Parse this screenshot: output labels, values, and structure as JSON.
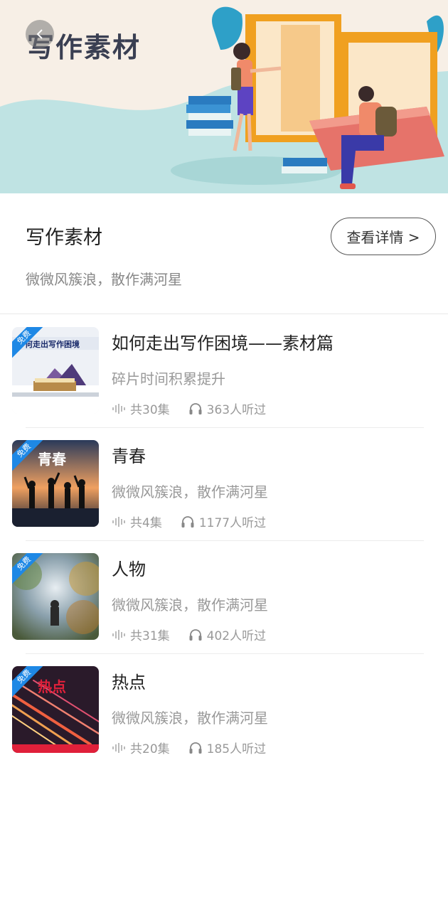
{
  "banner": {
    "title": "写作素材",
    "back_icon": "chevron-left-icon"
  },
  "info": {
    "title": "写作素材",
    "description": "微微风簇浪，散作满河星",
    "detail_button": "查看详情 >"
  },
  "list": [
    {
      "title": "如何走出写作困境——素材篇",
      "subtitle": "碎片时间积累提升",
      "episodes": "共30集",
      "listeners": "363人听过",
      "badge": "免费",
      "thumb_text": "何走出写作困境"
    },
    {
      "title": "青春",
      "subtitle": "微微风簇浪，散作满河星",
      "episodes": "共4集",
      "listeners": "1177人听过",
      "badge": "免费",
      "thumb_text": "青春"
    },
    {
      "title": "人物",
      "subtitle": "微微风簇浪，散作满河星",
      "episodes": "共31集",
      "listeners": "402人听过",
      "badge": "免费",
      "thumb_text": ""
    },
    {
      "title": "热点",
      "subtitle": "微微风簇浪，散作满河星",
      "episodes": "共20集",
      "listeners": "185人听过",
      "badge": "免费",
      "thumb_text": "热点"
    }
  ],
  "colors": {
    "badge": "#1e88e5",
    "accent_orange": "#f0a020",
    "banner_teal": "#bfe3e3"
  }
}
